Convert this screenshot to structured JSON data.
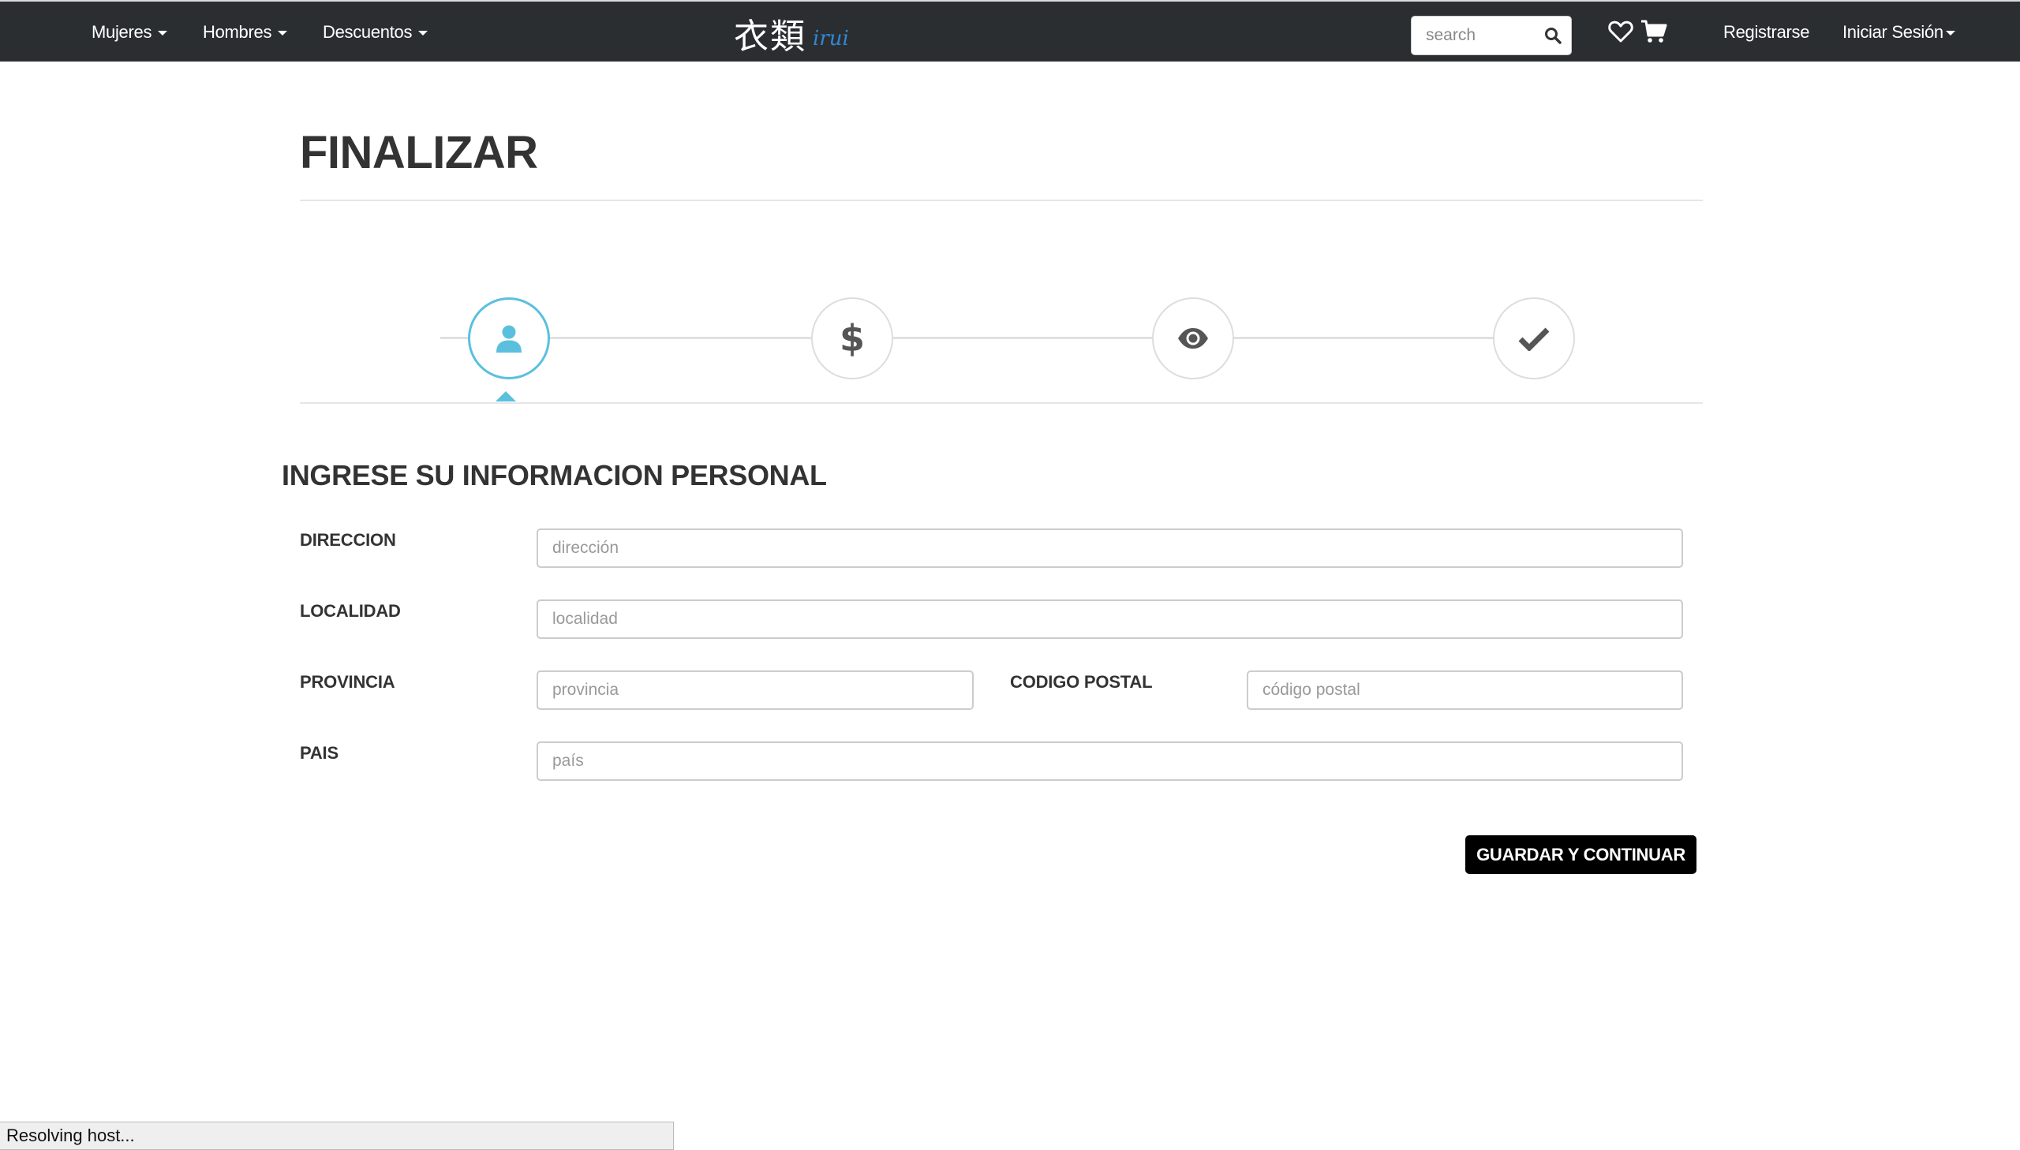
{
  "navbar": {
    "menu": [
      {
        "label": "Mujeres"
      },
      {
        "label": "Hombres"
      },
      {
        "label": "Descuentos"
      }
    ],
    "brand": {
      "cjk": "衣類",
      "sub": "irui"
    },
    "search": {
      "placeholder": "search"
    },
    "register_label": "Registrarse",
    "login_label": "Iniciar Sesión"
  },
  "page": {
    "title": "FINALIZAR"
  },
  "stepper": {
    "active_step": 1,
    "steps": [
      {
        "icon": "user-icon"
      },
      {
        "icon": "dollar-icon"
      },
      {
        "icon": "eye-icon"
      },
      {
        "icon": "check-icon"
      }
    ],
    "accent_color": "#5bc0de"
  },
  "form": {
    "section_title": "INGRESE SU INFORMACION PERSONAL",
    "direccion": {
      "label": "DIRECCION",
      "placeholder": "dirección",
      "value": ""
    },
    "localidad": {
      "label": "LOCALIDAD",
      "placeholder": "localidad",
      "value": ""
    },
    "provincia": {
      "label": "PROVINCIA",
      "placeholder": "provincia",
      "value": ""
    },
    "codigo_postal": {
      "label": "CODIGO POSTAL",
      "placeholder": "código postal",
      "value": ""
    },
    "pais": {
      "label": "PAIS",
      "placeholder": "país",
      "value": ""
    },
    "submit_label": "GUARDAR Y CONTINUAR"
  },
  "status_bar": {
    "text": "Resolving host..."
  },
  "colors": {
    "navbar_bg": "#2b2e31",
    "brand_accent": "#2f87d4",
    "button_bg": "#000000"
  }
}
